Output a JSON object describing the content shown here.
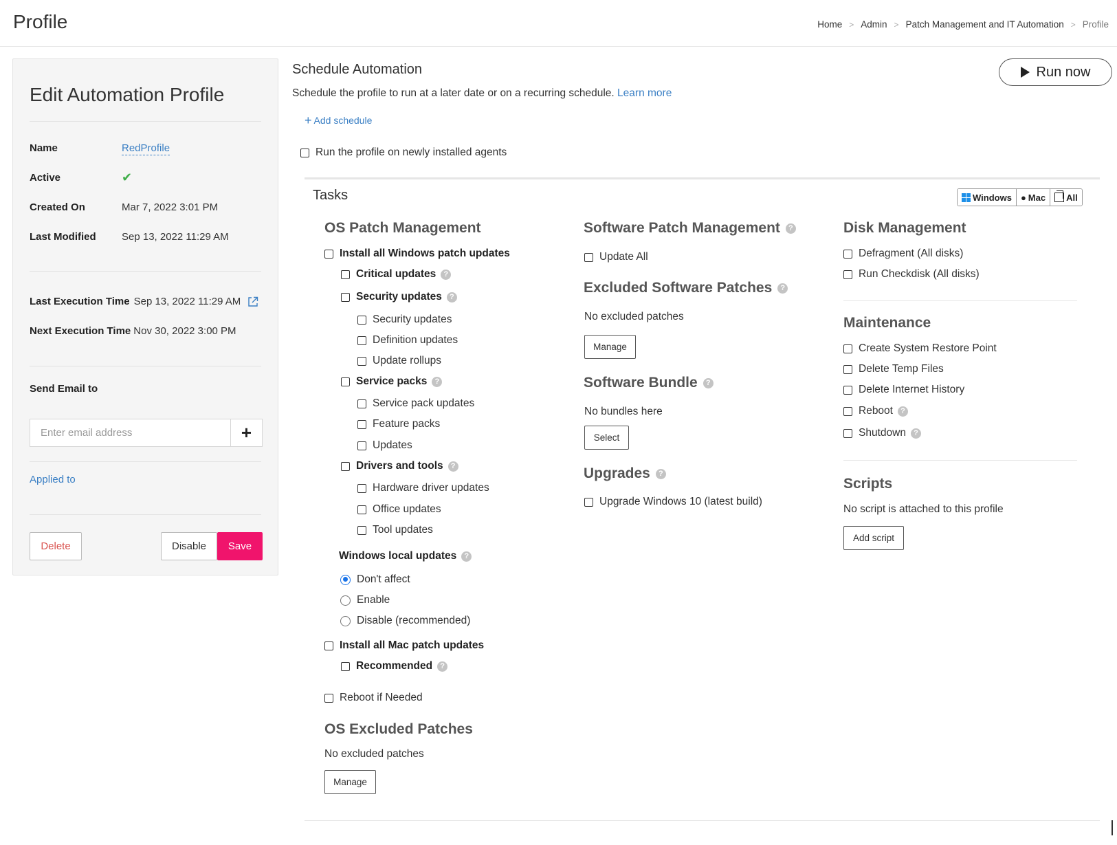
{
  "header": {
    "title": "Profile",
    "breadcrumb": [
      "Home",
      "Admin",
      "Patch Management and IT Automation",
      "Profile"
    ]
  },
  "profile_panel": {
    "title": "Edit Automation Profile",
    "name_label": "Name",
    "name_value": "RedProfile",
    "active_label": "Active",
    "active_value": "✔",
    "created_label": "Created On",
    "created_value": "Mar 7, 2022 3:01 PM",
    "modified_label": "Last Modified",
    "modified_value": "Sep 13, 2022 11:29 AM",
    "last_exec_label": "Last Execution Time",
    "last_exec_value": "Sep 13, 2022 11:29 AM",
    "next_exec_label": "Next Execution Time",
    "next_exec_value": "Nov 30, 2022 3:00 PM",
    "email_label": "Send Email to",
    "email_placeholder": "Enter email address",
    "email_value": "",
    "add_email_label": "+",
    "applied_to": "Applied to",
    "delete_label": "Delete",
    "disable_label": "Disable",
    "save_label": "Save"
  },
  "schedule": {
    "title": "Schedule Automation",
    "description": "Schedule the profile to run at a later date or on a recurring schedule.",
    "learn_more": "Learn more",
    "add_schedule": "Add schedule",
    "run_on_new_agents": "Run the profile on newly installed agents",
    "run_now": "Run now"
  },
  "tasks": {
    "title": "Tasks",
    "os_filter": {
      "windows": "Windows",
      "mac": "Mac",
      "all": "All"
    },
    "os_patch": {
      "heading": "OS Patch Management",
      "install_windows": "Install all Windows patch updates",
      "critical": "Critical updates",
      "security": "Security updates",
      "security_sub": [
        "Security updates",
        "Definition updates",
        "Update rollups"
      ],
      "service_packs": "Service packs",
      "service_packs_sub": [
        "Service pack updates",
        "Feature packs",
        "Updates"
      ],
      "drivers": "Drivers and tools",
      "drivers_sub": [
        "Hardware driver updates",
        "Office updates",
        "Tool updates"
      ],
      "local_updates_heading": "Windows local updates",
      "local_updates_options": [
        "Don't affect",
        "Enable",
        "Disable (recommended)"
      ],
      "local_updates_selected": "Don't affect",
      "install_mac": "Install all Mac patch updates",
      "recommended": "Recommended",
      "reboot_if_needed": "Reboot if Needed",
      "excluded_heading": "OS Excluded Patches",
      "excluded_text": "No excluded patches",
      "manage": "Manage"
    },
    "software_patch": {
      "heading": "Software Patch Management",
      "update_all": "Update All",
      "excluded_heading": "Excluded Software Patches",
      "excluded_text": "No excluded patches",
      "manage": "Manage",
      "bundle_heading": "Software Bundle",
      "bundle_text": "No bundles here",
      "select": "Select",
      "upgrades_heading": "Upgrades",
      "upgrade_win10": "Upgrade Windows 10 (latest build)"
    },
    "disk": {
      "heading": "Disk Management",
      "items": [
        "Defragment (All disks)",
        "Run Checkdisk (All disks)"
      ]
    },
    "maintenance": {
      "heading": "Maintenance",
      "items": [
        "Create System Restore Point",
        "Delete Temp Files",
        "Delete Internet History",
        "Reboot",
        "Shutdown"
      ]
    },
    "scripts": {
      "heading": "Scripts",
      "text": "No script is attached to this profile",
      "add_script": "Add script"
    }
  },
  "colors": {
    "accent": "#f0146c",
    "link": "#3a7fc4",
    "success": "#3fae49",
    "windows": "#1e90e8"
  }
}
